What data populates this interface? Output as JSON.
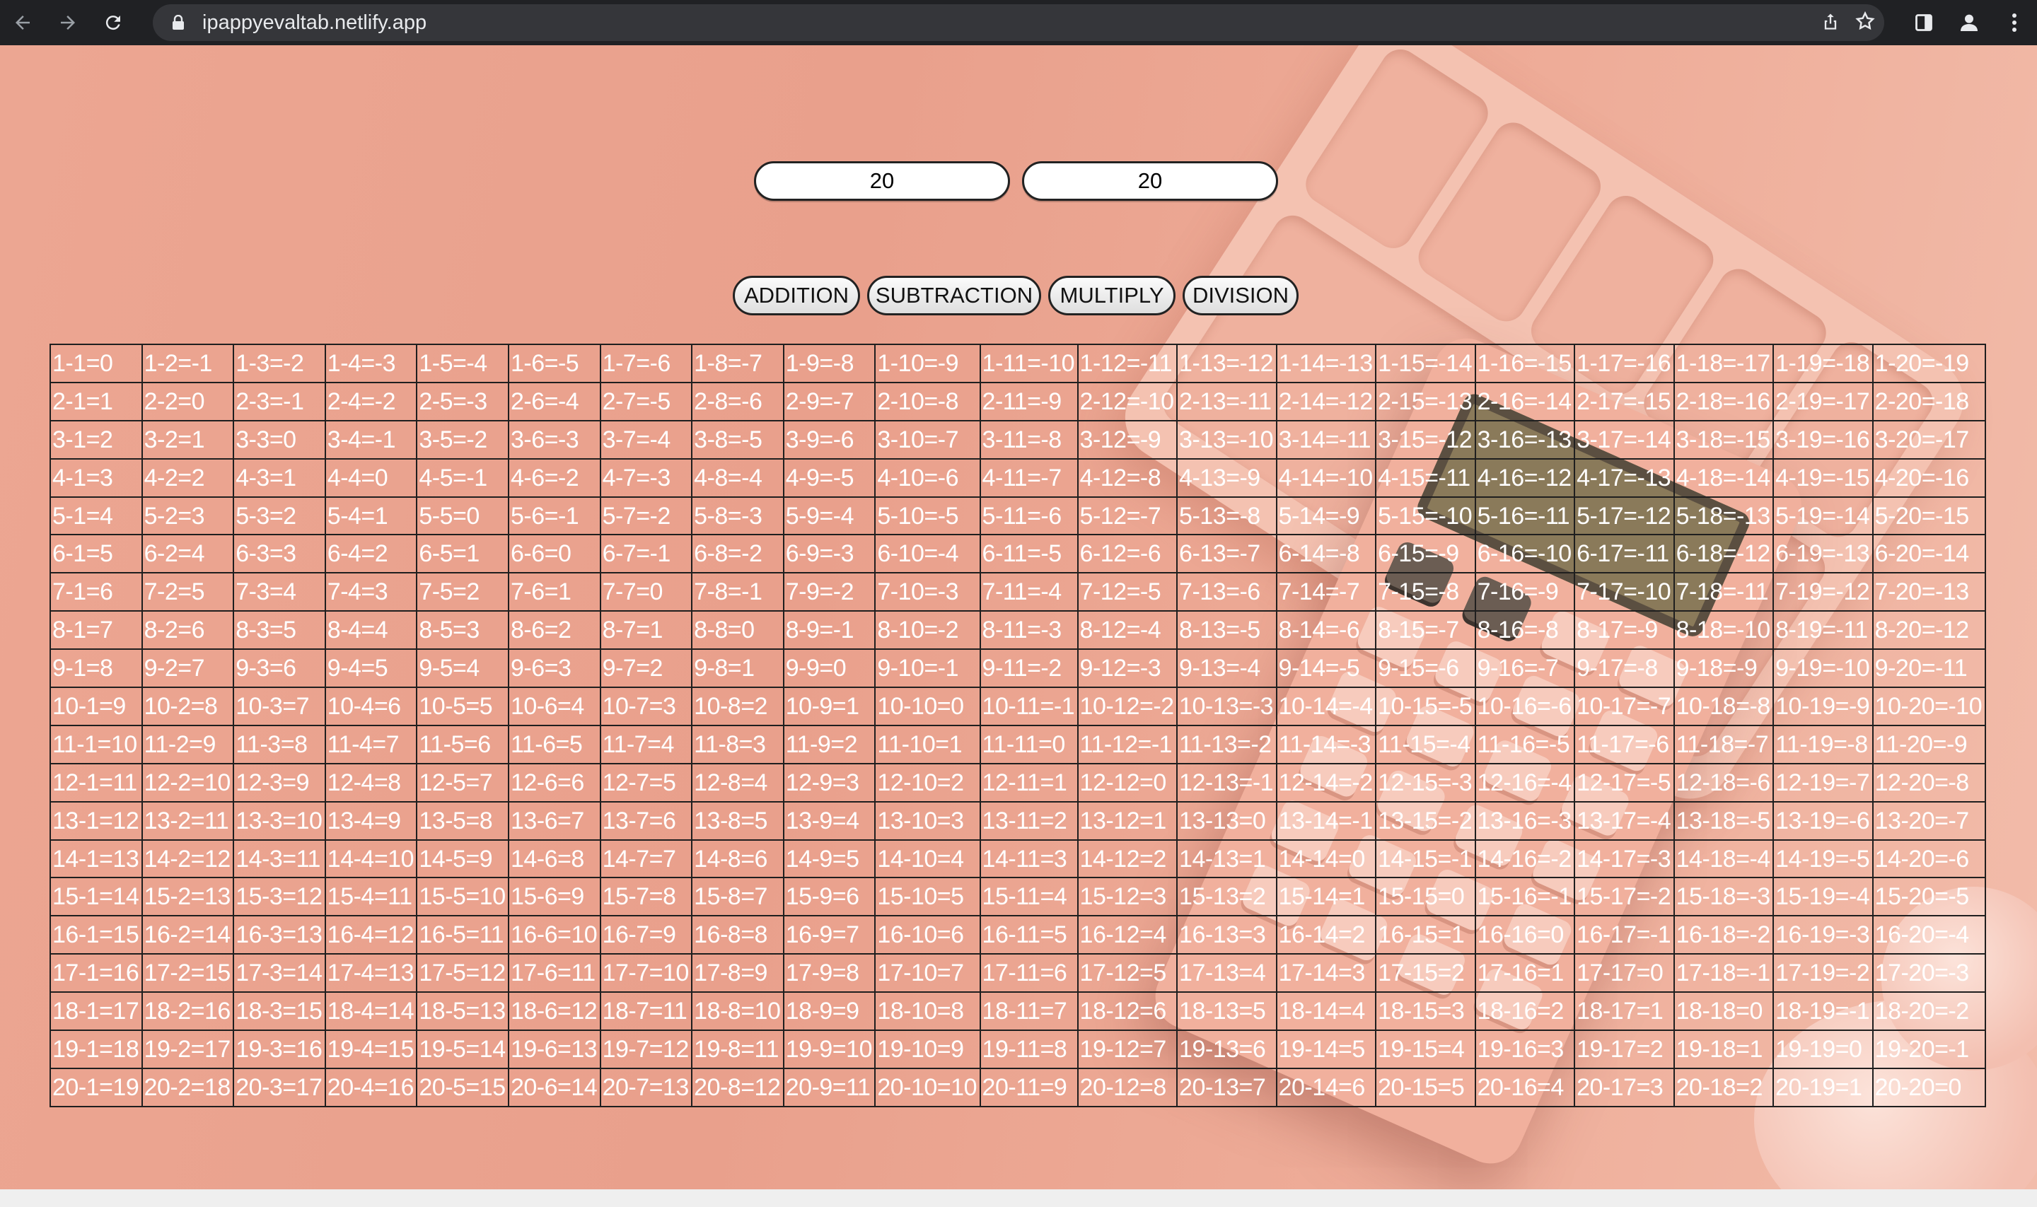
{
  "browser": {
    "url": "ipappyevaltab.netlify.app",
    "icons": [
      "back-icon",
      "forward-icon",
      "reload-icon",
      "lock-icon",
      "share-icon",
      "star-icon",
      "sidebar-icon",
      "profile-icon",
      "more-icon"
    ]
  },
  "inputs": {
    "first_value": "20",
    "second_value": "20"
  },
  "operations": [
    "ADDITION",
    "SUBTRACTION",
    "MULTIPLY",
    "DIVISION"
  ],
  "table": {
    "operation": "subtraction",
    "rows": [
      [
        "1-1=0",
        "1-2=-1",
        "1-3=-2",
        "1-4=-3",
        "1-5=-4",
        "1-6=-5",
        "1-7=-6",
        "1-8=-7",
        "1-9=-8",
        "1-10=-9",
        "1-11=-10",
        "1-12=-11",
        "1-13=-12",
        "1-14=-13",
        "1-15=-14",
        "1-16=-15",
        "1-17=-16",
        "1-18=-17",
        "1-19=-18",
        "1-20=-19"
      ],
      [
        "2-1=1",
        "2-2=0",
        "2-3=-1",
        "2-4=-2",
        "2-5=-3",
        "2-6=-4",
        "2-7=-5",
        "2-8=-6",
        "2-9=-7",
        "2-10=-8",
        "2-11=-9",
        "2-12=-10",
        "2-13=-11",
        "2-14=-12",
        "2-15=-13",
        "2-16=-14",
        "2-17=-15",
        "2-18=-16",
        "2-19=-17",
        "2-20=-18"
      ],
      [
        "3-1=2",
        "3-2=1",
        "3-3=0",
        "3-4=-1",
        "3-5=-2",
        "3-6=-3",
        "3-7=-4",
        "3-8=-5",
        "3-9=-6",
        "3-10=-7",
        "3-11=-8",
        "3-12=-9",
        "3-13=-10",
        "3-14=-11",
        "3-15=-12",
        "3-16=-13",
        "3-17=-14",
        "3-18=-15",
        "3-19=-16",
        "3-20=-17"
      ],
      [
        "4-1=3",
        "4-2=2",
        "4-3=1",
        "4-4=0",
        "4-5=-1",
        "4-6=-2",
        "4-7=-3",
        "4-8=-4",
        "4-9=-5",
        "4-10=-6",
        "4-11=-7",
        "4-12=-8",
        "4-13=-9",
        "4-14=-10",
        "4-15=-11",
        "4-16=-12",
        "4-17=-13",
        "4-18=-14",
        "4-19=-15",
        "4-20=-16"
      ],
      [
        "5-1=4",
        "5-2=3",
        "5-3=2",
        "5-4=1",
        "5-5=0",
        "5-6=-1",
        "5-7=-2",
        "5-8=-3",
        "5-9=-4",
        "5-10=-5",
        "5-11=-6",
        "5-12=-7",
        "5-13=-8",
        "5-14=-9",
        "5-15=-10",
        "5-16=-11",
        "5-17=-12",
        "5-18=-13",
        "5-19=-14",
        "5-20=-15"
      ],
      [
        "6-1=5",
        "6-2=4",
        "6-3=3",
        "6-4=2",
        "6-5=1",
        "6-6=0",
        "6-7=-1",
        "6-8=-2",
        "6-9=-3",
        "6-10=-4",
        "6-11=-5",
        "6-12=-6",
        "6-13=-7",
        "6-14=-8",
        "6-15=-9",
        "6-16=-10",
        "6-17=-11",
        "6-18=-12",
        "6-19=-13",
        "6-20=-14"
      ],
      [
        "7-1=6",
        "7-2=5",
        "7-3=4",
        "7-4=3",
        "7-5=2",
        "7-6=1",
        "7-7=0",
        "7-8=-1",
        "7-9=-2",
        "7-10=-3",
        "7-11=-4",
        "7-12=-5",
        "7-13=-6",
        "7-14=-7",
        "7-15=-8",
        "7-16=-9",
        "7-17=-10",
        "7-18=-11",
        "7-19=-12",
        "7-20=-13"
      ],
      [
        "8-1=7",
        "8-2=6",
        "8-3=5",
        "8-4=4",
        "8-5=3",
        "8-6=2",
        "8-7=1",
        "8-8=0",
        "8-9=-1",
        "8-10=-2",
        "8-11=-3",
        "8-12=-4",
        "8-13=-5",
        "8-14=-6",
        "8-15=-7",
        "8-16=-8",
        "8-17=-9",
        "8-18=-10",
        "8-19=-11",
        "8-20=-12"
      ],
      [
        "9-1=8",
        "9-2=7",
        "9-3=6",
        "9-4=5",
        "9-5=4",
        "9-6=3",
        "9-7=2",
        "9-8=1",
        "9-9=0",
        "9-10=-1",
        "9-11=-2",
        "9-12=-3",
        "9-13=-4",
        "9-14=-5",
        "9-15=-6",
        "9-16=-7",
        "9-17=-8",
        "9-18=-9",
        "9-19=-10",
        "9-20=-11"
      ],
      [
        "10-1=9",
        "10-2=8",
        "10-3=7",
        "10-4=6",
        "10-5=5",
        "10-6=4",
        "10-7=3",
        "10-8=2",
        "10-9=1",
        "10-10=0",
        "10-11=-1",
        "10-12=-2",
        "10-13=-3",
        "10-14=-4",
        "10-15=-5",
        "10-16=-6",
        "10-17=-7",
        "10-18=-8",
        "10-19=-9",
        "10-20=-10"
      ],
      [
        "11-1=10",
        "11-2=9",
        "11-3=8",
        "11-4=7",
        "11-5=6",
        "11-6=5",
        "11-7=4",
        "11-8=3",
        "11-9=2",
        "11-10=1",
        "11-11=0",
        "11-12=-1",
        "11-13=-2",
        "11-14=-3",
        "11-15=-4",
        "11-16=-5",
        "11-17=-6",
        "11-18=-7",
        "11-19=-8",
        "11-20=-9"
      ],
      [
        "12-1=11",
        "12-2=10",
        "12-3=9",
        "12-4=8",
        "12-5=7",
        "12-6=6",
        "12-7=5",
        "12-8=4",
        "12-9=3",
        "12-10=2",
        "12-11=1",
        "12-12=0",
        "12-13=-1",
        "12-14=-2",
        "12-15=-3",
        "12-16=-4",
        "12-17=-5",
        "12-18=-6",
        "12-19=-7",
        "12-20=-8"
      ],
      [
        "13-1=12",
        "13-2=11",
        "13-3=10",
        "13-4=9",
        "13-5=8",
        "13-6=7",
        "13-7=6",
        "13-8=5",
        "13-9=4",
        "13-10=3",
        "13-11=2",
        "13-12=1",
        "13-13=0",
        "13-14=-1",
        "13-15=-2",
        "13-16=-3",
        "13-17=-4",
        "13-18=-5",
        "13-19=-6",
        "13-20=-7"
      ],
      [
        "14-1=13",
        "14-2=12",
        "14-3=11",
        "14-4=10",
        "14-5=9",
        "14-6=8",
        "14-7=7",
        "14-8=6",
        "14-9=5",
        "14-10=4",
        "14-11=3",
        "14-12=2",
        "14-13=1",
        "14-14=0",
        "14-15=-1",
        "14-16=-2",
        "14-17=-3",
        "14-18=-4",
        "14-19=-5",
        "14-20=-6"
      ],
      [
        "15-1=14",
        "15-2=13",
        "15-3=12",
        "15-4=11",
        "15-5=10",
        "15-6=9",
        "15-7=8",
        "15-8=7",
        "15-9=6",
        "15-10=5",
        "15-11=4",
        "15-12=3",
        "15-13=2",
        "15-14=1",
        "15-15=0",
        "15-16=-1",
        "15-17=-2",
        "15-18=-3",
        "15-19=-4",
        "15-20=-5"
      ],
      [
        "16-1=15",
        "16-2=14",
        "16-3=13",
        "16-4=12",
        "16-5=11",
        "16-6=10",
        "16-7=9",
        "16-8=8",
        "16-9=7",
        "16-10=6",
        "16-11=5",
        "16-12=4",
        "16-13=3",
        "16-14=2",
        "16-15=1",
        "16-16=0",
        "16-17=-1",
        "16-18=-2",
        "16-19=-3",
        "16-20=-4"
      ],
      [
        "17-1=16",
        "17-2=15",
        "17-3=14",
        "17-4=13",
        "17-5=12",
        "17-6=11",
        "17-7=10",
        "17-8=9",
        "17-9=8",
        "17-10=7",
        "17-11=6",
        "17-12=5",
        "17-13=4",
        "17-14=3",
        "17-15=2",
        "17-16=1",
        "17-17=0",
        "17-18=-1",
        "17-19=-2",
        "17-20=-3"
      ],
      [
        "18-1=17",
        "18-2=16",
        "18-3=15",
        "18-4=14",
        "18-5=13",
        "18-6=12",
        "18-7=11",
        "18-8=10",
        "18-9=9",
        "18-10=8",
        "18-11=7",
        "18-12=6",
        "18-13=5",
        "18-14=4",
        "18-15=3",
        "18-16=2",
        "18-17=1",
        "18-18=0",
        "18-19=-1",
        "18-20=-2"
      ],
      [
        "19-1=18",
        "19-2=17",
        "19-3=16",
        "19-4=15",
        "19-5=14",
        "19-6=13",
        "19-7=12",
        "19-8=11",
        "19-9=10",
        "19-10=9",
        "19-11=8",
        "19-12=7",
        "19-13=6",
        "19-14=5",
        "19-15=4",
        "19-16=3",
        "19-17=2",
        "19-18=1",
        "19-19=0",
        "19-20=-1"
      ],
      [
        "20-1=19",
        "20-2=18",
        "20-3=17",
        "20-4=16",
        "20-5=15",
        "20-6=14",
        "20-7=13",
        "20-8=12",
        "20-9=11",
        "20-10=10",
        "20-11=9",
        "20-12=8",
        "20-13=7",
        "20-14=6",
        "20-15=5",
        "20-16=4",
        "20-17=3",
        "20-18=2",
        "20-19=1",
        "20-20=0"
      ]
    ]
  }
}
